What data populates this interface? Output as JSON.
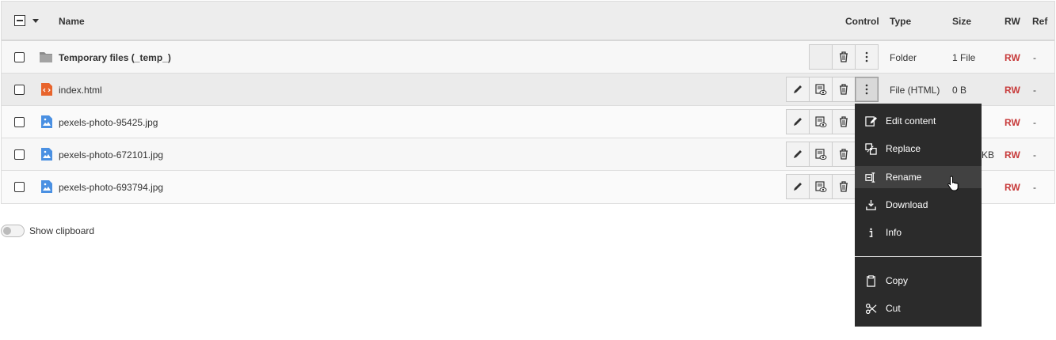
{
  "header": {
    "name": "Name",
    "control": "Control",
    "type": "Type",
    "size": "Size",
    "rw": "RW",
    "ref": "Ref"
  },
  "rows": [
    {
      "name": "Temporary files (_temp_)",
      "type": "Folder",
      "size": "1 File",
      "rw": "RW",
      "ref": "-",
      "icon": "folder-icon"
    },
    {
      "name": "index.html",
      "type": "File (HTML)",
      "size": "0 B",
      "rw": "RW",
      "ref": "-",
      "icon": "html-file-icon"
    },
    {
      "name": "pexels-photo-95425.jpg",
      "rw": "RW",
      "ref": "-",
      "icon": "image-file-icon"
    },
    {
      "name": "pexels-photo-672101.jpg",
      "size_partial": "KB",
      "rw": "RW",
      "ref": "-",
      "icon": "image-file-icon"
    },
    {
      "name": "pexels-photo-693794.jpg",
      "rw": "RW",
      "ref": "-",
      "icon": "image-file-icon"
    }
  ],
  "clipboard": {
    "label": "Show clipboard"
  },
  "context_menu": {
    "items": [
      {
        "label": "Edit content",
        "icon": "edit-content-icon"
      },
      {
        "label": "Replace",
        "icon": "replace-icon"
      },
      {
        "label": "Rename",
        "icon": "rename-icon"
      },
      {
        "label": "Download",
        "icon": "download-icon"
      },
      {
        "label": "Info",
        "icon": "info-icon"
      },
      {
        "label": "Copy",
        "icon": "copy-icon"
      },
      {
        "label": "Cut",
        "icon": "cut-icon"
      }
    ]
  }
}
